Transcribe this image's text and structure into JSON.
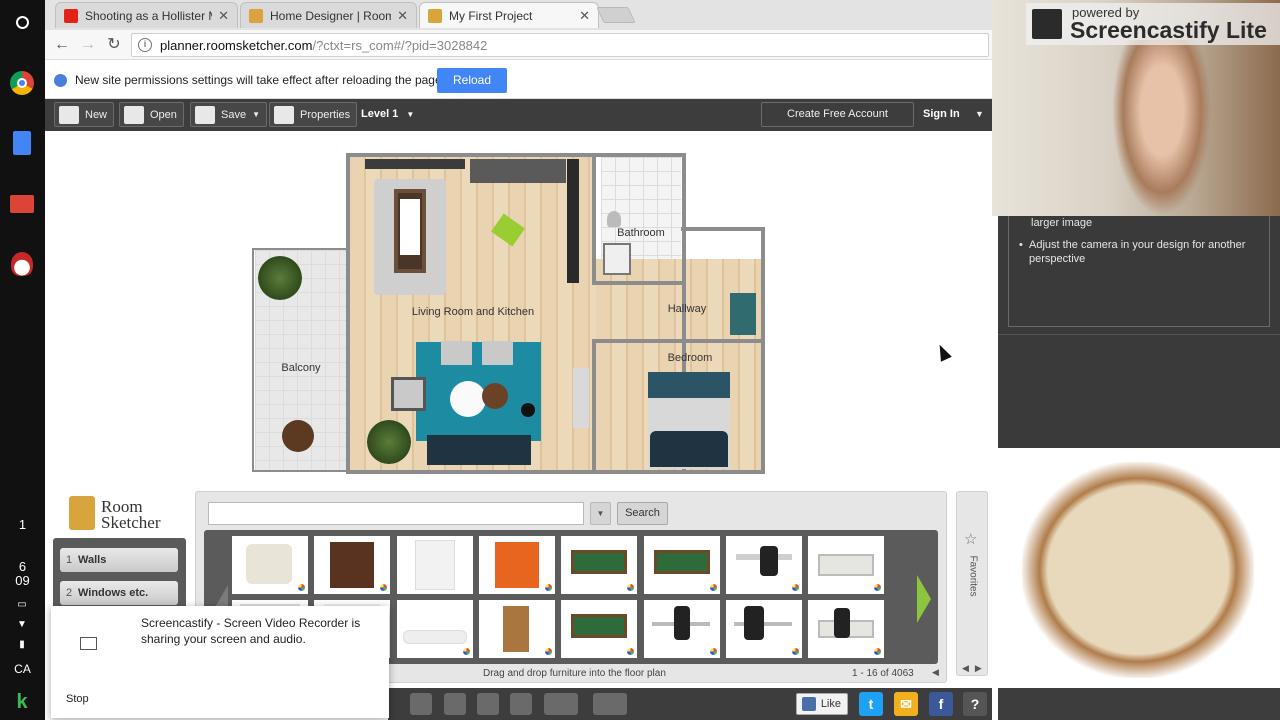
{
  "shelf": {
    "items": [
      "launcher-icon",
      "chrome-icon",
      "docs-icon",
      "gmail-icon",
      "santa-icon"
    ],
    "badge": "1",
    "time_hour": "6",
    "time_min": "09",
    "locale": "CA"
  },
  "tabs": [
    {
      "title": "Shooting as a Hollister M",
      "icon": "youtube-icon",
      "color": "#e62117"
    },
    {
      "title": "Home Designer | RoomS",
      "icon": "roomsketcher-icon",
      "color": "#d8a53d"
    },
    {
      "title": "My First Project",
      "icon": "roomsketcher-icon",
      "color": "#d8a53d",
      "active": true
    }
  ],
  "omnibox": {
    "host": "planner.roomsketcher.com",
    "path": "/?ctxt=rs_com#/?pid=3028842"
  },
  "infobar": {
    "message": "New site permissions settings will take effect after reloading the page.",
    "reload_label": "Reload"
  },
  "app_toolbar": {
    "new_label": "New",
    "open_label": "Open",
    "save_label": "Save",
    "properties_label": "Properties",
    "level_label": "Level 1",
    "create_account_label": "Create Free Account",
    "sign_in_label": "Sign In"
  },
  "floorplan": {
    "rooms": [
      "Bathroom",
      "Hallway",
      "Living Room and Kitchen",
      "Balcony",
      "Bedroom"
    ]
  },
  "library": {
    "logo_line1": "Room",
    "logo_line2": "Sketcher",
    "categories": [
      {
        "num": "1",
        "label": "Walls"
      },
      {
        "num": "2",
        "label": "Windows etc."
      }
    ],
    "search_placeholder": "",
    "search_label": "Search",
    "hint": "Drag and drop furniture into the floor plan",
    "count": "1 - 16 of 4063",
    "favorites_label": "Favorites",
    "colors": {
      "accent_green": "#8cc63f",
      "toolbar_bg": "#3d3d3d"
    }
  },
  "bottombar": {
    "like_label": "Like",
    "twitter_glyph": "t",
    "mail_glyph": "✉",
    "facebook_glyph": "f",
    "help_glyph": "?"
  },
  "notification": {
    "message": "Screencastify - Screen Video Recorder is sharing your screen and audio.",
    "stop_label": "Stop"
  },
  "watermark": {
    "powered_by": "powered by",
    "brand": "Screencastify Lite"
  },
  "tips": {
    "line0": "larger image",
    "line1": "Adjust the camera in your design for another perspective"
  }
}
